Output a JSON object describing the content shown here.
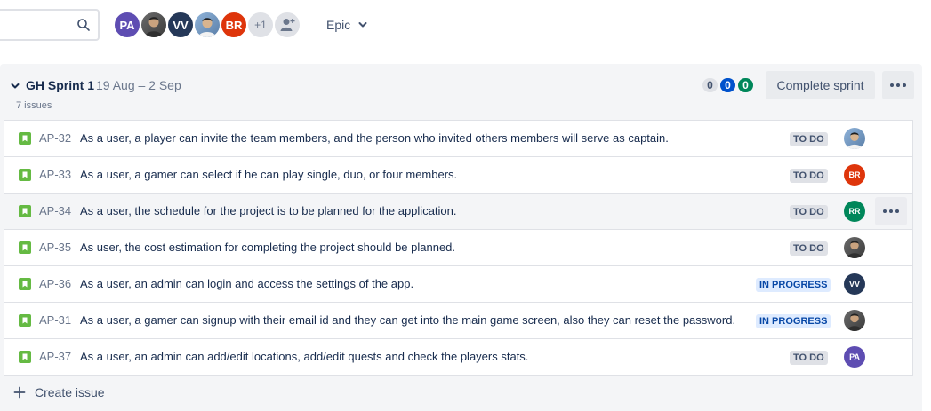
{
  "toolbar": {
    "search_placeholder": "",
    "avatars": [
      {
        "initials": "PA",
        "kind": "pa"
      },
      {
        "initials": "",
        "kind": "photo1"
      },
      {
        "initials": "VV",
        "kind": "vv"
      },
      {
        "initials": "",
        "kind": "photo2"
      },
      {
        "initials": "BR",
        "kind": "br"
      },
      {
        "initials": "+1",
        "kind": "more"
      }
    ],
    "epic_label": "Epic"
  },
  "sprint": {
    "name": "GH Sprint 1",
    "dates": "19 Aug – 2 Sep",
    "issue_count": "7 issues",
    "counts": {
      "todo": "0",
      "in_progress": "0",
      "done": "0"
    },
    "complete_label": "Complete sprint"
  },
  "issues": [
    {
      "key": "AP-32",
      "summary": "As a user, a player can invite the team members, and the person who invited others members will serve as captain.",
      "status": "TO DO",
      "assignee": "",
      "assignee_kind": "p2"
    },
    {
      "key": "AP-33",
      "summary": "As a user, a gamer can select if he can play single, duo, or four members.",
      "status": "TO DO",
      "assignee": "BR",
      "assignee_kind": "br"
    },
    {
      "key": "AP-34",
      "summary": "As a user, the schedule for the project is to be planned for the application.",
      "status": "TO DO",
      "assignee": "RR",
      "assignee_kind": "rr"
    },
    {
      "key": "AP-35",
      "summary": "As user, the cost estimation for completing the project should be planned.",
      "status": "TO DO",
      "assignee": "",
      "assignee_kind": "p1"
    },
    {
      "key": "AP-36",
      "summary": "As a user, an admin can login and access the settings of the app.",
      "status": "IN PROGRESS",
      "assignee": "VV",
      "assignee_kind": "vv"
    },
    {
      "key": "AP-31",
      "summary": "As a user, a gamer can signup with their email id and they can get into the main game screen, also they can reset the password.",
      "status": "IN PROGRESS",
      "assignee": "",
      "assignee_kind": "p1"
    },
    {
      "key": "AP-37",
      "summary": "As a user, an admin can add/edit locations, add/edit quests and check the players stats.",
      "status": "TO DO",
      "assignee": "PA",
      "assignee_kind": "pa"
    }
  ],
  "create_issue_label": "Create issue",
  "colors": {
    "story": "#65ba43",
    "todo_bg": "#dfe1e6",
    "progress_bg": "#deebff",
    "progress_fg": "#0747a6",
    "brand_blue": "#0052cc",
    "done_green": "#00875a"
  },
  "icons": [
    "search-icon",
    "chevron-down-icon",
    "more-icon",
    "story-icon",
    "plus-icon",
    "add-person-icon"
  ]
}
